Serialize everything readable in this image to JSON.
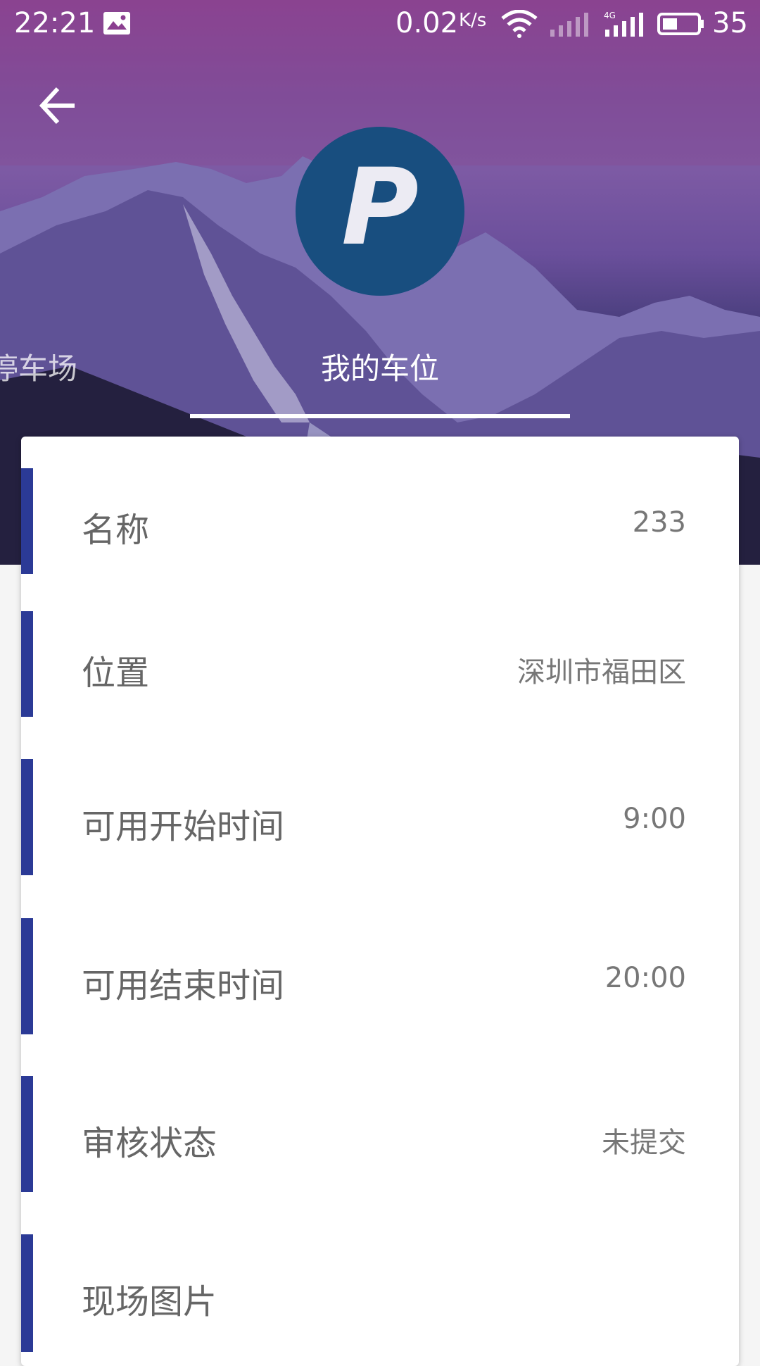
{
  "status_bar": {
    "time": "22:21",
    "net_speed": "0.02",
    "net_speed_unit": "K/s",
    "battery": "35",
    "icons": [
      "image-icon",
      "wifi-icon",
      "signal-icon",
      "signal-4g-icon",
      "battery-icon"
    ]
  },
  "header": {
    "back_icon": "arrow-left-icon",
    "logo_letter": "P",
    "tabs": [
      {
        "label": "停车场"
      },
      {
        "label": "我的车位"
      }
    ],
    "active_tab": 1
  },
  "details": [
    {
      "label": "名称",
      "value": "233"
    },
    {
      "label": "位置",
      "value": "深圳市福田区"
    },
    {
      "label": "可用开始时间",
      "value": "9:00"
    },
    {
      "label": "可用结束时间",
      "value": "20:00"
    },
    {
      "label": "审核状态",
      "value": "未提交"
    },
    {
      "label": "现场图片",
      "value": ""
    }
  ],
  "colors": {
    "accent_bar": "#2b3a96",
    "logo_bg": "#184e7f",
    "header_top": "#8b3f90"
  }
}
